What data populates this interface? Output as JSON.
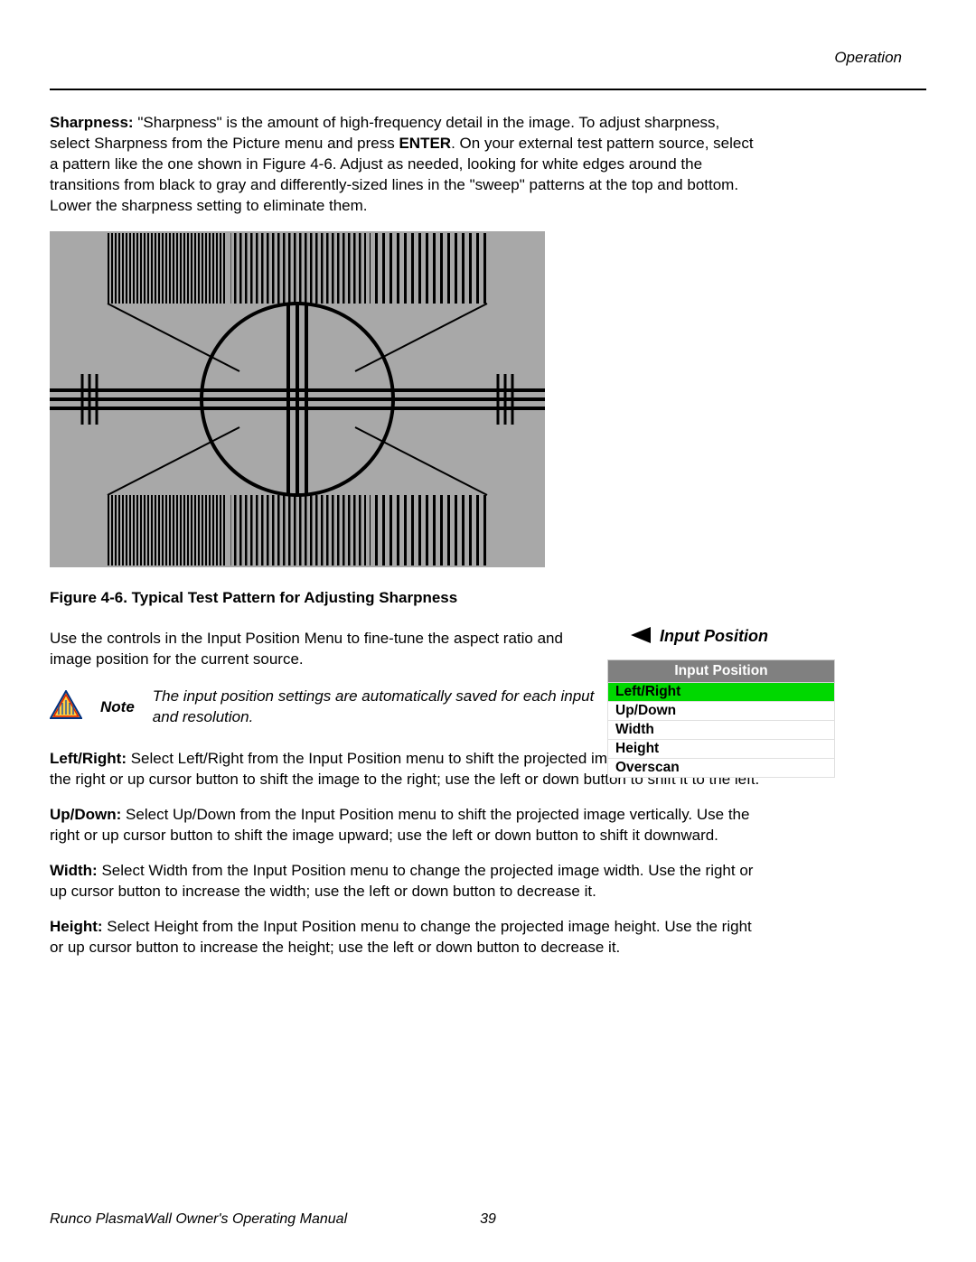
{
  "header": {
    "section": "Operation"
  },
  "sharpness_para": {
    "label": "Sharpness:",
    "text_before_enter": " \"Sharpness\" is the amount of high-frequency detail in the image. To adjust sharpness, select Sharpness from the Picture menu and press ",
    "enter": "ENTER",
    "text_after_enter": ". On your external test pattern source, select a pattern like the one shown in Figure 4-6. Adjust as needed, looking for white edges around the transitions from black to gray and differently-sized lines in the \"sweep\" patterns at the top and bottom. Lower the sharpness setting to eliminate them."
  },
  "figure_caption": "Figure 4-6. Typical Test Pattern for Adjusting Sharpness",
  "input_position_intro": "Use the controls in the Input Position Menu to fine-tune the aspect ratio and image position for the current source.",
  "note": {
    "label": "Note",
    "text": "The input position settings are automatically saved for each input and resolution."
  },
  "items": {
    "left_right": {
      "label": "Left/Right:",
      "text": " Select Left/Right from the Input Position menu to shift the projected image horizontally. Use the right or up cursor button to shift the image to the right; use the left or down button to shift it to the left."
    },
    "up_down": {
      "label": "Up/Down:",
      "text": " Select Up/Down from the Input Position menu to shift the projected image vertically. Use the right or up cursor button to shift the image upward; use the left or down button to shift it downward."
    },
    "width": {
      "label": "Width:",
      "text": " Select Width from the Input Position menu to change the projected image width. Use the right or up cursor button to increase the width; use the left or down button to decrease it."
    },
    "height": {
      "label": "Height:",
      "text": " Select Height from the Input Position menu to change the projected image height. Use the right or up cursor button to increase the height; use the left or down button to decrease it."
    }
  },
  "sidebar": {
    "heading": "Input Position",
    "menu": {
      "title": "Input Position",
      "items": [
        "Left/Right",
        "Up/Down",
        "Width",
        "Height",
        "Overscan"
      ],
      "selected_index": 0
    }
  },
  "footer": {
    "manual": "Runco PlasmaWall Owner's Operating Manual",
    "page": "39"
  }
}
